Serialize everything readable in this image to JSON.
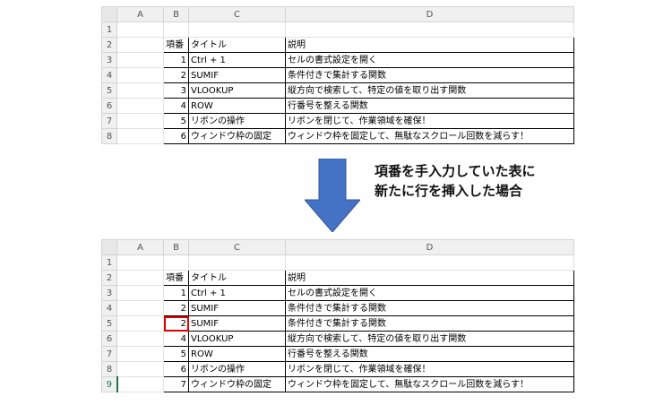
{
  "top_sheet": {
    "col_headers": [
      "A",
      "B",
      "C",
      "D"
    ],
    "row_numbers": [
      "1",
      "2",
      "3",
      "4",
      "5",
      "6",
      "7",
      "8"
    ],
    "header": [
      "項番",
      "タイトル",
      "説明"
    ],
    "rows": [
      [
        "1",
        "Ctrl + 1",
        "セルの書式設定を開く"
      ],
      [
        "2",
        "SUMIF",
        "条件付きで集計する関数"
      ],
      [
        "3",
        "VLOOKUP",
        "縦方向で検索して、特定の値を取り出す関数"
      ],
      [
        "4",
        "ROW",
        "行番号を整える関数"
      ],
      [
        "5",
        "リボンの操作",
        "リボンを閉じて、作業領域を確保！"
      ],
      [
        "6",
        "ウィンドウ枠の固定",
        "ウィンドウ枠を固定して、無駄なスクロール回数を減らす！"
      ]
    ]
  },
  "caption": {
    "line1": "項番を手入力していた表に",
    "line2": "新たに行を挿入した場合"
  },
  "bottom_sheet": {
    "col_headers": [
      "A",
      "B",
      "C",
      "D"
    ],
    "row_numbers": [
      "1",
      "2",
      "3",
      "4",
      "5",
      "6",
      "7",
      "8",
      "9"
    ],
    "header": [
      "項番",
      "タイトル",
      "説明"
    ],
    "rows": [
      [
        "1",
        "Ctrl + 1",
        "セルの書式設定を開く"
      ],
      [
        "2",
        "SUMIF",
        "条件付きで集計する関数"
      ],
      [
        "2",
        "SUMIF",
        "条件付きで集計する関数"
      ],
      [
        "4",
        "VLOOKUP",
        "縦方向で検索して、特定の値を取り出す関数"
      ],
      [
        "5",
        "ROW",
        "行番号を整える関数"
      ],
      [
        "6",
        "リボンの操作",
        "リボンを閉じて、作業領域を確保！"
      ],
      [
        "7",
        "ウィンドウ枠の固定",
        "ウィンドウ枠を固定して、無駄なスクロール回数を減らす！"
      ]
    ],
    "highlighted_row_index": 2
  },
  "colors": {
    "arrow": "#4472c4",
    "highlight": "#e00000",
    "excel_green": "#217346"
  }
}
